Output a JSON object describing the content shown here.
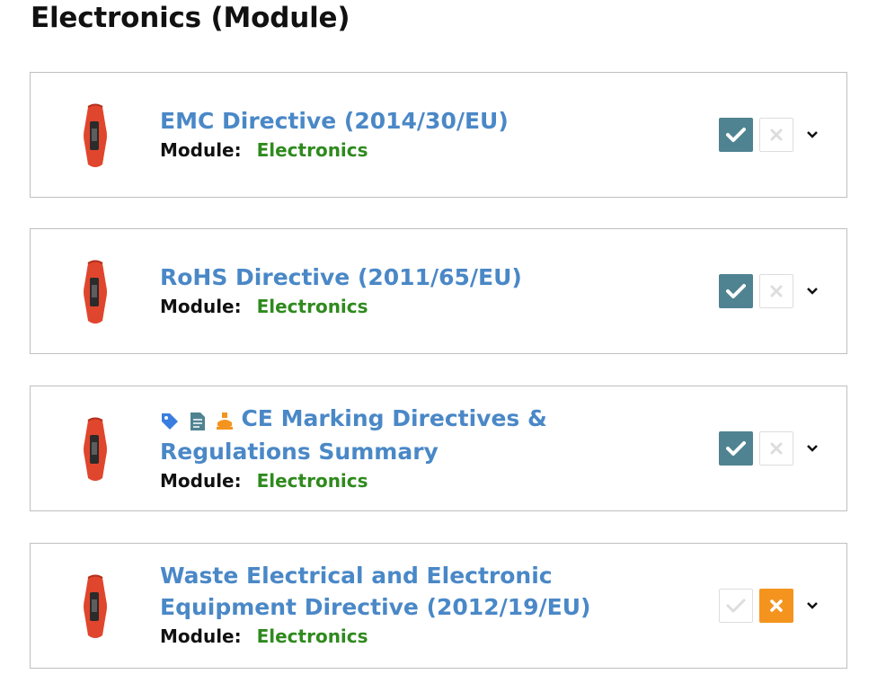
{
  "page": {
    "title": "Electronics (Module)"
  },
  "colors": {
    "title_link": "#4a88c7",
    "module_value": "#2f8a1e",
    "approve_active": "#4f8391",
    "reject_active": "#f4941f",
    "inactive_icon": "#dddddd"
  },
  "items": [
    {
      "title": "EMC Directive (2014/30/EU)",
      "module_label": "Module:",
      "module_value": "Electronics",
      "badges": [],
      "approved": true,
      "rejected": false
    },
    {
      "title": "RoHS Directive (2011/65/EU)",
      "module_label": "Module:",
      "module_value": "Electronics",
      "badges": [],
      "approved": true,
      "rejected": false
    },
    {
      "title": "CE Marking Directives & Regulations Summary",
      "module_label": "Module:",
      "module_value": "Electronics",
      "badges": [
        "tag-icon",
        "document-icon",
        "flask-icon"
      ],
      "approved": true,
      "rejected": false
    },
    {
      "title": "Waste Electrical and Electronic Equipment Directive (2012/19/EU)",
      "module_label": "Module:",
      "module_value": "Electronics",
      "badges": [],
      "approved": false,
      "rejected": true
    }
  ]
}
